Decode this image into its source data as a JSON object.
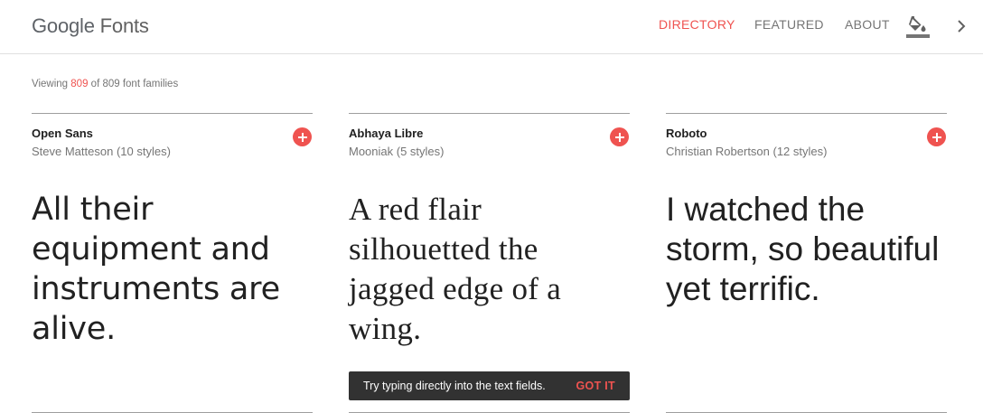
{
  "header": {
    "logo_google": "Google",
    "logo_fonts": "Fonts",
    "nav": {
      "directory": "DIRECTORY",
      "featured": "FEATURED",
      "about": "ABOUT"
    },
    "icons": [
      "paint-bucket-icon",
      "chevron-right-icon"
    ],
    "accent_color": "#ef5350"
  },
  "viewing": {
    "prefix": "Viewing",
    "shown": "809",
    "middle": "of 809 font families"
  },
  "cards": [
    {
      "family": "Open Sans",
      "designer": "Steve Matteson (10 styles)",
      "sample": "All their equipment and instruments are alive."
    },
    {
      "family": "Abhaya Libre",
      "designer": "Mooniak (5 styles)",
      "sample": "A red flair silhouetted the jagged edge of a wing."
    },
    {
      "family": "Roboto",
      "designer": "Christian Robertson (12 styles)",
      "sample": "I watched the storm, so beautiful yet terrific."
    }
  ],
  "snackbar": {
    "message": "Try typing directly into the text fields.",
    "action": "GOT IT"
  }
}
